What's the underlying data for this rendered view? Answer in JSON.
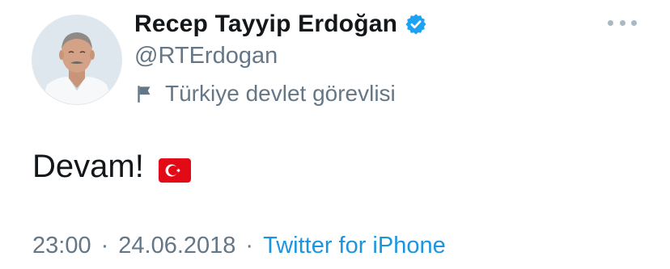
{
  "tweet": {
    "author": {
      "display_name": "Recep Tayyip Erdoğan",
      "handle": "@RTErdogan",
      "verified": true,
      "label": "Türkiye devlet görevlisi",
      "avatar_icon": "profile-photo",
      "label_icon": "flag-icon"
    },
    "text": "Devam!",
    "emoji": "turkish-flag",
    "time": "23:00",
    "date": "24.06.2018",
    "separator": "·",
    "source": "Twitter for iPhone"
  },
  "colors": {
    "primary_text": "#14171a",
    "secondary_text": "#657786",
    "link": "#1b95e0",
    "verified_badge": "#1da1f2",
    "flag_red": "#e30a17"
  }
}
